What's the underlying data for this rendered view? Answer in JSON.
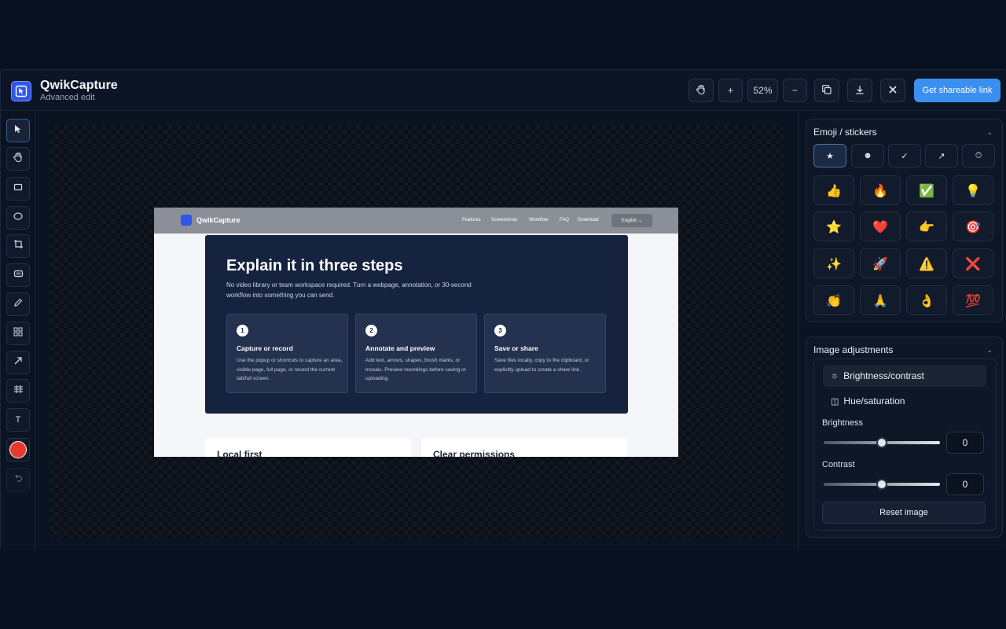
{
  "header": {
    "title": "QwikCapture",
    "subtitle": "Advanced edit",
    "zoom": "52%",
    "zoom_in": "+",
    "zoom_out": "−",
    "share_label": "Get shareable link"
  },
  "toolbar": {
    "tools": [
      "select-tool",
      "hand-tool",
      "rectangle-tool",
      "ellipse-tool",
      "crop-tool",
      "blur-tool",
      "pen-tool",
      "mosaic-tool",
      "arrow-tool",
      "text-tool",
      "color-swatch",
      "undo-tool"
    ],
    "text_tool_label": "T",
    "color": "#e5392f"
  },
  "screenshot": {
    "brand": "QwikCapture",
    "nav": [
      "Features",
      "Screenshots",
      "Workflow",
      "FAQ",
      "Download"
    ],
    "language": "English",
    "hero_title": "Explain it in three steps",
    "hero_text": "No video library or team workspace required. Turn a webpage, annotation, or 30-second workflow into something you can send.",
    "steps": [
      {
        "num": "1",
        "title": "Capture or record",
        "text": "Use the popup or shortcuts to capture an area, visible page, full page, or record the current tab/full screen."
      },
      {
        "num": "2",
        "title": "Annotate and preview",
        "text": "Add text, arrows, shapes, brush marks, or mosaic. Preview recordings before saving or uploading."
      },
      {
        "num": "3",
        "title": "Save or share",
        "text": "Save files locally, copy to the clipboard, or explicitly upload to create a share link."
      }
    ],
    "cards": [
      "Local first",
      "Clear permissions"
    ]
  },
  "emoji_panel": {
    "title": "Emoji / stickers",
    "tabs": [
      "★",
      "☻",
      "✓",
      "↗",
      "⏱"
    ],
    "emojis": [
      "👍",
      "🔥",
      "✅",
      "💡",
      "⭐",
      "❤️",
      "👉",
      "🎯",
      "✨",
      "🚀",
      "⚠️",
      "❌",
      "👏",
      "🙏",
      "👌",
      "💯"
    ]
  },
  "adjust_panel": {
    "title": "Image adjustments",
    "tab_brightness": "Brightness/contrast",
    "tab_hue": "Hue/saturation",
    "brightness_label": "Brightness",
    "brightness_value": "0",
    "contrast_label": "Contrast",
    "contrast_value": "0",
    "reset_label": "Reset image"
  },
  "colors": {
    "accent": "#3b8ff0",
    "brand": "#2f55e9",
    "hero": "#15233f"
  }
}
